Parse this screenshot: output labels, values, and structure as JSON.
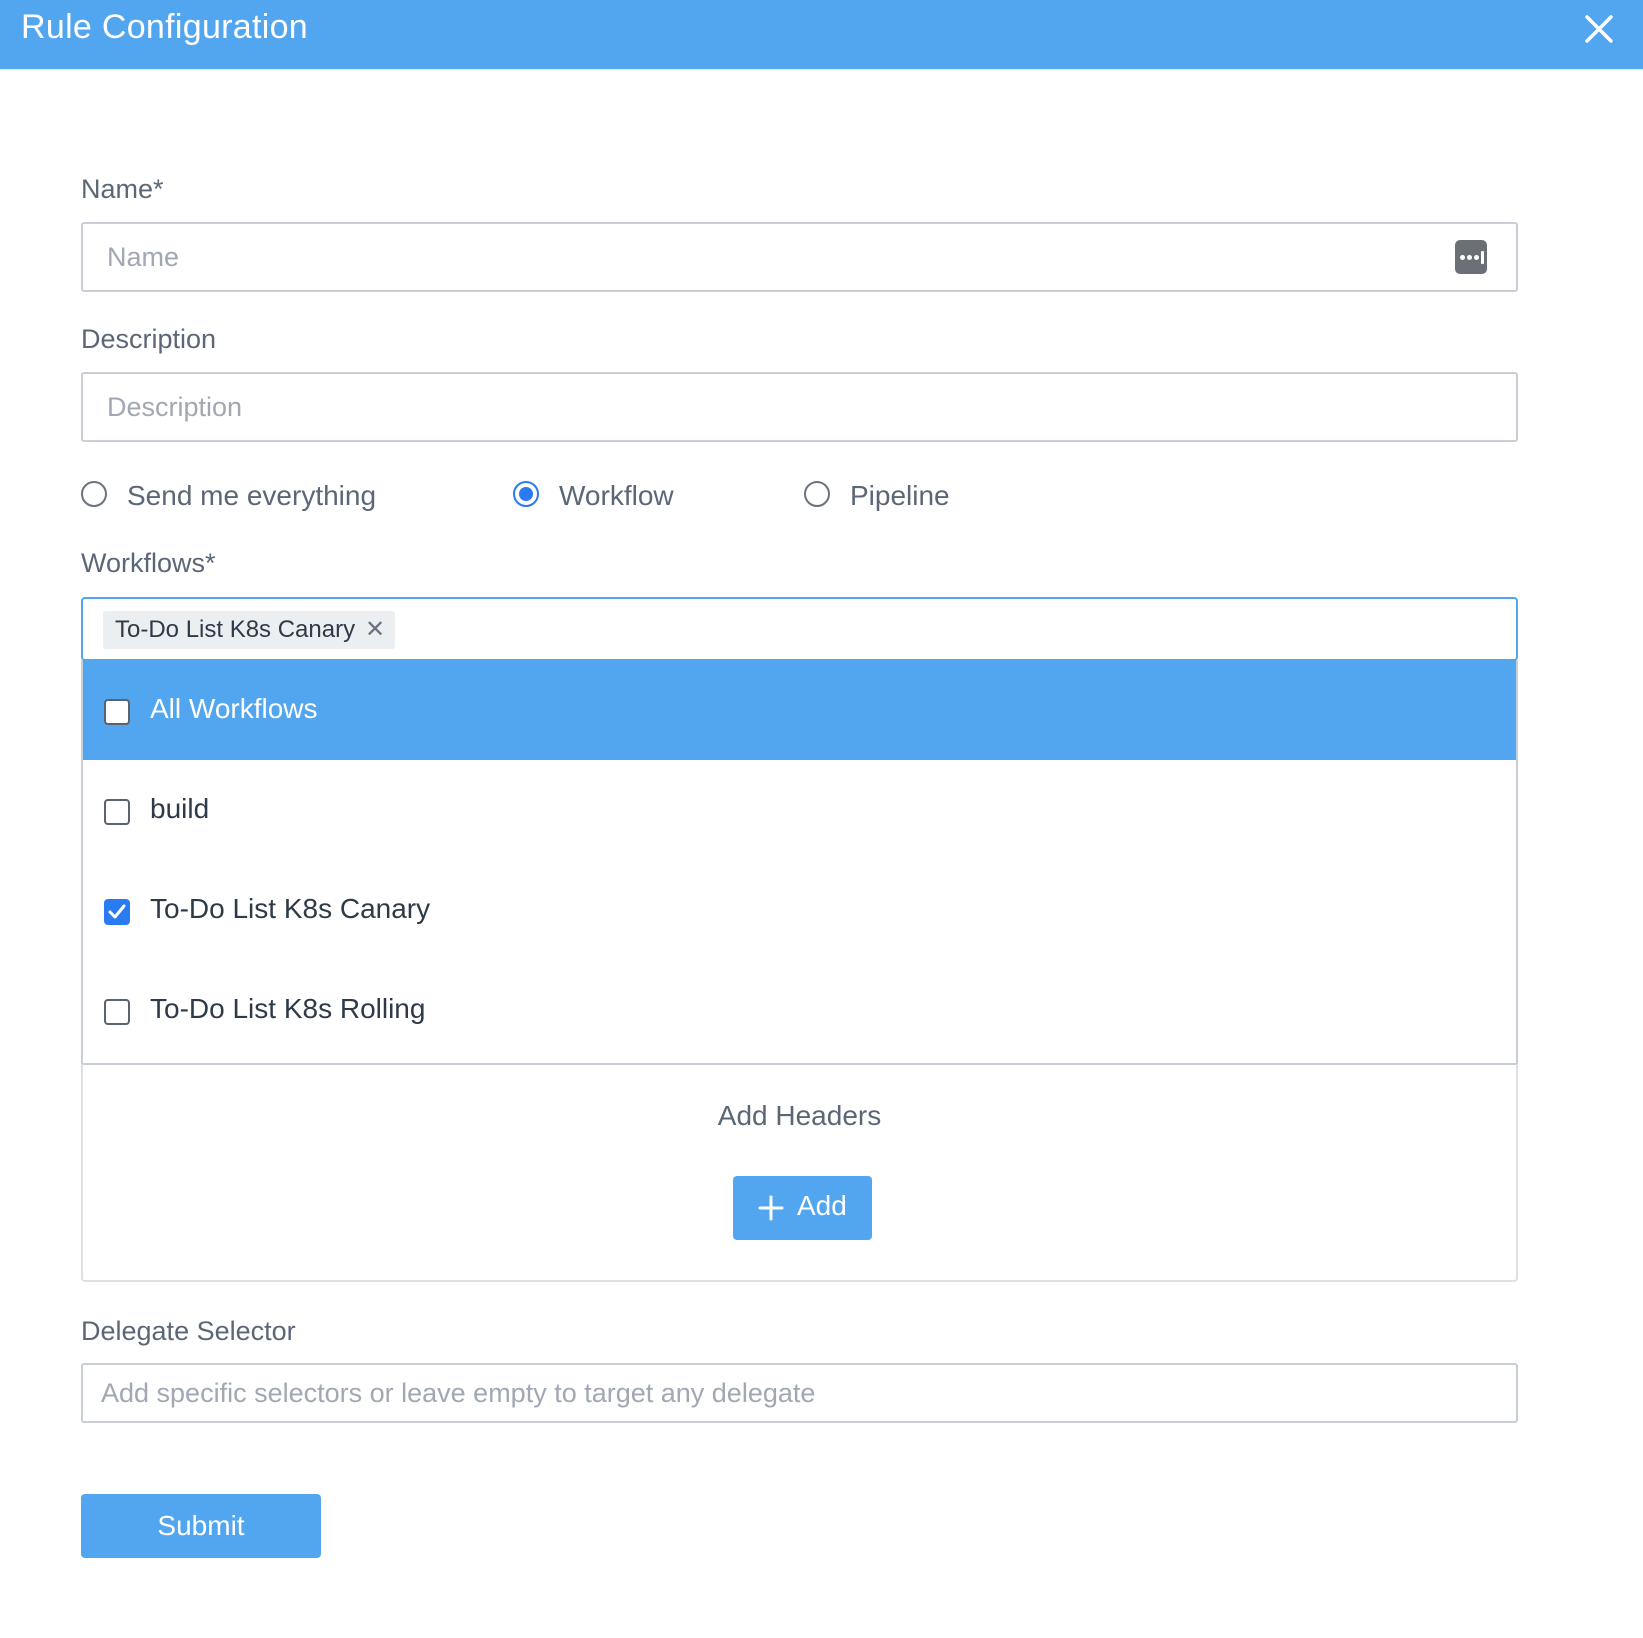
{
  "header": {
    "title": "Rule Configuration",
    "close_icon": "close-icon"
  },
  "form": {
    "name": {
      "label": "Name*",
      "placeholder": "Name",
      "value": "",
      "icon": "more-icon"
    },
    "description": {
      "label": "Description",
      "placeholder": "Description",
      "value": ""
    },
    "scope": {
      "options": [
        {
          "label": "Send me everything",
          "selected": false
        },
        {
          "label": "Workflow",
          "selected": true
        },
        {
          "label": "Pipeline",
          "selected": false
        }
      ]
    },
    "workflows": {
      "label": "Workflows*",
      "selected_chips": [
        "To-Do List K8s Canary"
      ],
      "chip_remove_glyph": "✕",
      "options": [
        {
          "label": "All Workflows",
          "checked": false,
          "highlighted": true
        },
        {
          "label": "build",
          "checked": false,
          "highlighted": false
        },
        {
          "label": "To-Do List K8s Canary",
          "checked": true,
          "highlighted": false
        },
        {
          "label": "To-Do List K8s Rolling",
          "checked": false,
          "highlighted": false
        }
      ]
    },
    "headers": {
      "title": "Add Headers",
      "add_label": "Add",
      "add_icon": "plus-icon"
    },
    "delegate_selector": {
      "label": "Delegate Selector",
      "placeholder": "Add specific selectors or leave empty to target any delegate",
      "value": ""
    },
    "submit_label": "Submit"
  },
  "colors": {
    "accent": "#52a6ef",
    "checkbox_checked": "#2a7bf2"
  }
}
